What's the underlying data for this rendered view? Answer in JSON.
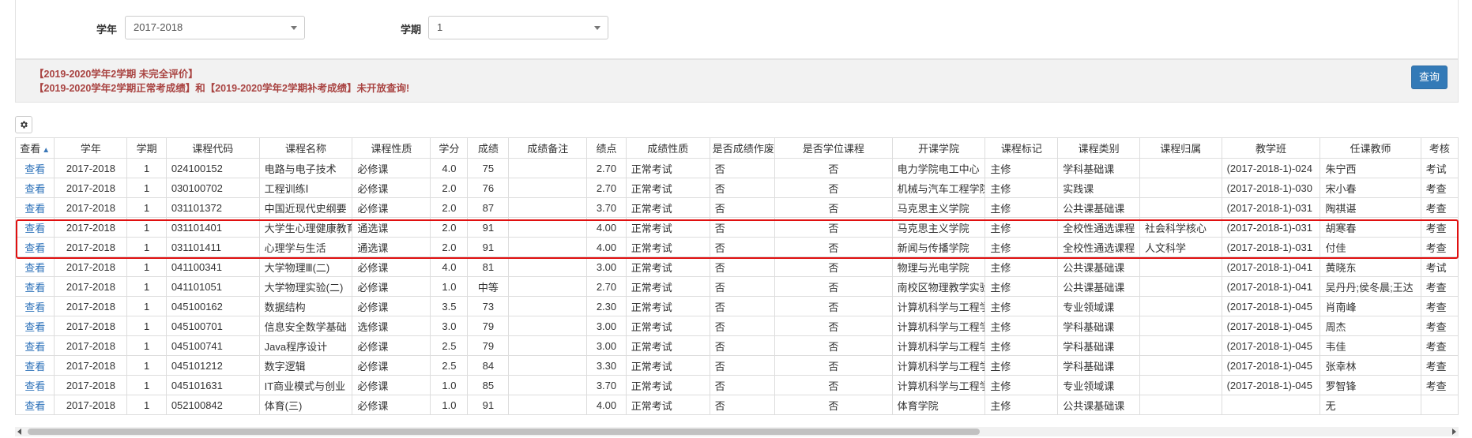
{
  "filters": {
    "year_label": "学年",
    "year_value": "2017-2018",
    "term_label": "学期",
    "term_value": "1"
  },
  "notice": {
    "line1": "【2019-2020学年2学期 未完全评价】",
    "line2": "【2019-2020学年2学期正常考成绩】和【2019-2020学年2学期补考成绩】未开放查询!"
  },
  "query_button": "查询",
  "table": {
    "headers": [
      "查看",
      "学年",
      "学期",
      "课程代码",
      "课程名称",
      "课程性质",
      "学分",
      "成绩",
      "成绩备注",
      "绩点",
      "成绩性质",
      "是否成绩作废",
      "是否学位课程",
      "开课学院",
      "课程标记",
      "课程类别",
      "课程归属",
      "教学班",
      "任课教师",
      "考核"
    ],
    "rows": [
      [
        "查看",
        "2017-2018",
        "1",
        "024100152",
        "电路与电子技术",
        "必修课",
        "4.0",
        "75",
        "",
        "2.70",
        "正常考试",
        "否",
        "否",
        "电力学院电工中心",
        "主修",
        "学科基础课",
        "",
        "(2017-2018-1)-024",
        "朱宁西",
        "考试"
      ],
      [
        "查看",
        "2017-2018",
        "1",
        "030100702",
        "工程训练Ⅰ",
        "必修课",
        "2.0",
        "76",
        "",
        "2.70",
        "正常考试",
        "否",
        "否",
        "机械与汽车工程学院",
        "主修",
        "实践课",
        "",
        "(2017-2018-1)-030",
        "宋小春",
        "考查"
      ],
      [
        "查看",
        "2017-2018",
        "1",
        "031101372",
        "中国近现代史纲要",
        "必修课",
        "2.0",
        "87",
        "",
        "3.70",
        "正常考试",
        "否",
        "否",
        "马克思主义学院",
        "主修",
        "公共课基础课",
        "",
        "(2017-2018-1)-031",
        "陶祺谌",
        "考查"
      ],
      [
        "查看",
        "2017-2018",
        "1",
        "031101401",
        "大学生心理健康教育",
        "通选课",
        "2.0",
        "91",
        "",
        "4.00",
        "正常考试",
        "否",
        "否",
        "马克思主义学院",
        "主修",
        "全校性通选课程",
        "社会科学核心",
        "(2017-2018-1)-031",
        "胡寒春",
        "考查"
      ],
      [
        "查看",
        "2017-2018",
        "1",
        "031101411",
        "心理学与生活",
        "通选课",
        "2.0",
        "91",
        "",
        "4.00",
        "正常考试",
        "否",
        "否",
        "新闻与传播学院",
        "主修",
        "全校性通选课程",
        "人文科学",
        "(2017-2018-1)-031",
        "付佳",
        "考查"
      ],
      [
        "查看",
        "2017-2018",
        "1",
        "041100341",
        "大学物理Ⅲ(二)",
        "必修课",
        "4.0",
        "81",
        "",
        "3.00",
        "正常考试",
        "否",
        "否",
        "物理与光电学院",
        "主修",
        "公共课基础课",
        "",
        "(2017-2018-1)-041",
        "黄晓东",
        "考试"
      ],
      [
        "查看",
        "2017-2018",
        "1",
        "041101051",
        "大学物理实验(二)",
        "必修课",
        "1.0",
        "中等",
        "",
        "2.70",
        "正常考试",
        "否",
        "否",
        "南校区物理教学实验中心",
        "主修",
        "公共课基础课",
        "",
        "(2017-2018-1)-041",
        "吴丹丹;侯冬晨;王达",
        "考查"
      ],
      [
        "查看",
        "2017-2018",
        "1",
        "045100162",
        "数据结构",
        "必修课",
        "3.5",
        "73",
        "",
        "2.30",
        "正常考试",
        "否",
        "否",
        "计算机科学与工程学院",
        "主修",
        "专业领域课",
        "",
        "(2017-2018-1)-045",
        "肖南峰",
        "考查"
      ],
      [
        "查看",
        "2017-2018",
        "1",
        "045100701",
        "信息安全数学基础",
        "选修课",
        "3.0",
        "79",
        "",
        "3.00",
        "正常考试",
        "否",
        "否",
        "计算机科学与工程学院",
        "主修",
        "学科基础课",
        "",
        "(2017-2018-1)-045",
        "周杰",
        "考查"
      ],
      [
        "查看",
        "2017-2018",
        "1",
        "045100741",
        "Java程序设计",
        "必修课",
        "2.5",
        "79",
        "",
        "3.00",
        "正常考试",
        "否",
        "否",
        "计算机科学与工程学院",
        "主修",
        "学科基础课",
        "",
        "(2017-2018-1)-045",
        "韦佳",
        "考查"
      ],
      [
        "查看",
        "2017-2018",
        "1",
        "045101212",
        "数字逻辑",
        "必修课",
        "2.5",
        "84",
        "",
        "3.30",
        "正常考试",
        "否",
        "否",
        "计算机科学与工程学院",
        "主修",
        "学科基础课",
        "",
        "(2017-2018-1)-045",
        "张幸林",
        "考查"
      ],
      [
        "查看",
        "2017-2018",
        "1",
        "045101631",
        "IT商业模式与创业",
        "必修课",
        "1.0",
        "85",
        "",
        "3.70",
        "正常考试",
        "否",
        "否",
        "计算机科学与工程学院",
        "主修",
        "专业领域课",
        "",
        "(2017-2018-1)-045",
        "罗智锋",
        "考查"
      ],
      [
        "查看",
        "2017-2018",
        "1",
        "052100842",
        "体育(三)",
        "必修课",
        "1.0",
        "91",
        "",
        "4.00",
        "正常考试",
        "否",
        "否",
        "体育学院",
        "主修",
        "公共课基础课",
        "",
        "",
        "无",
        ""
      ]
    ]
  },
  "colors": {
    "link": "#2a6fb8",
    "notice_text": "#a94442",
    "primary_button": "#337ab7",
    "highlight_border": "#e01010"
  },
  "icons": {
    "settings": "gear-icon",
    "sort": "sort-icon",
    "dropdown": "caret-down-icon"
  }
}
